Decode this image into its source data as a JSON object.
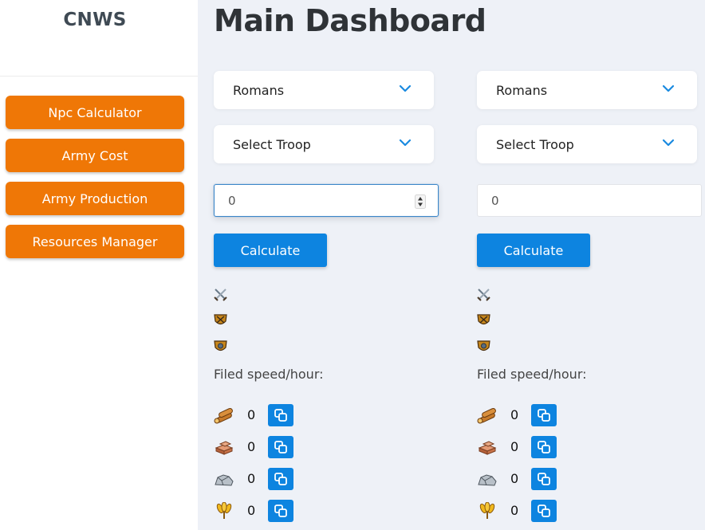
{
  "sidebar": {
    "brand": "CNWS",
    "items": [
      {
        "label": "Npc Calculator"
      },
      {
        "label": "Army Cost"
      },
      {
        "label": "Army Production"
      },
      {
        "label": "Resources Manager"
      }
    ]
  },
  "page": {
    "title": "Main Dashboard"
  },
  "columns": [
    {
      "tribe_select": "Romans",
      "troop_select": "Select Troop",
      "quantity": "0",
      "calculate_label": "Calculate",
      "speed_label": "Filed speed/hour:",
      "resources": {
        "wood": "0",
        "clay": "0",
        "iron": "0",
        "crop": "0"
      }
    },
    {
      "tribe_select": "Romans",
      "troop_select": "Select Troop",
      "quantity": "0",
      "calculate_label": "Calculate",
      "speed_label": "Filed speed/hour:",
      "resources": {
        "wood": "0",
        "clay": "0",
        "iron": "0",
        "crop": "0"
      }
    }
  ],
  "colors": {
    "nav": "#ef7706",
    "primary": "#0d84e0",
    "background": "#eef1f7"
  }
}
